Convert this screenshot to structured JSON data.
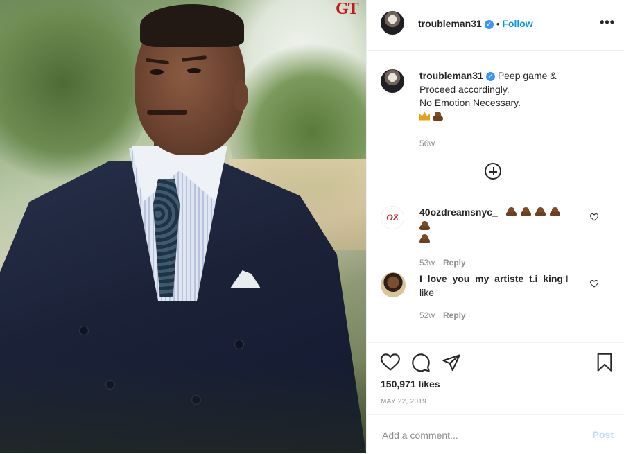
{
  "post": {
    "author": {
      "username": "troubleman31",
      "verified": true,
      "follow_label": "Follow",
      "separator": "•"
    },
    "photo": {
      "watermark": "GT",
      "description_icon": "portrait-photo"
    },
    "caption": {
      "username": "troubleman31",
      "lines": [
        "Peep game &",
        "Proceed accordingly.",
        "No Emotion Necessary."
      ],
      "emojis": [
        "crown-icon",
        "poo-icon"
      ],
      "time": "56w"
    },
    "load_more_icon": "plus-circle-icon",
    "comments": [
      {
        "username": "40ozdreamsnyc_",
        "avatar_text": "OZ",
        "emoji_count": 6,
        "emoji": "poo-icon",
        "time": "53w",
        "reply_label": "Reply"
      },
      {
        "username": "I_love_you_my_artiste_t.i_king",
        "text": "I like",
        "time": "52w",
        "reply_label": "Reply"
      }
    ],
    "stats": {
      "likes": "150,971 likes",
      "date": "MAY 22, 2019"
    },
    "add_comment": {
      "placeholder": "Add a comment...",
      "post_label": "Post"
    },
    "more_label": "•••"
  }
}
